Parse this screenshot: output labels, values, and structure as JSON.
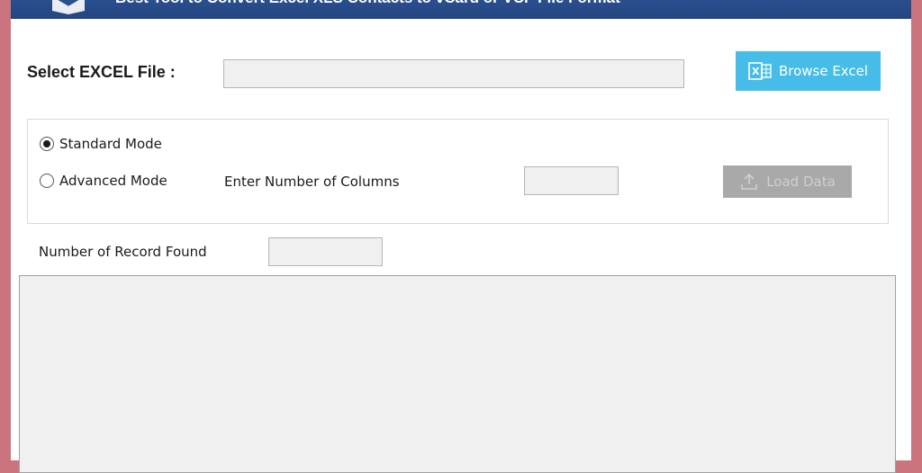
{
  "header": {
    "title": "Best Tool to Convert Excel XLS Contacts to vCard or VCF File Format"
  },
  "file_select": {
    "label": "Select EXCEL File :",
    "value": "",
    "browse_label": "Browse Excel"
  },
  "mode": {
    "standard_label": "Standard Mode",
    "advanced_label": "Advanced Mode",
    "selected": "standard",
    "columns_label": "Enter Number of Columns",
    "columns_value": "",
    "load_label": "Load Data"
  },
  "records": {
    "label": "Number of Record Found",
    "value": ""
  },
  "colors": {
    "header": "#234680",
    "browse_button": "#45bde8",
    "load_button_disabled": "#a9a9a9",
    "frame": "#c9747f"
  },
  "icons": {
    "browse": "excel-icon",
    "load": "upload-icon",
    "logo": "app-logo-icon"
  }
}
